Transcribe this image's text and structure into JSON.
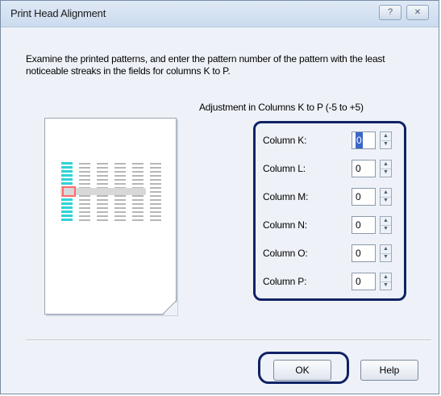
{
  "window": {
    "title": "Print Head Alignment",
    "help_glyph": "?",
    "close_glyph": "✕"
  },
  "instructions": "Examine the printed patterns, and enter the pattern number of the pattern with the least noticeable streaks in the fields for columns K to P.",
  "adjustment_label": "Adjustment in Columns K to P (-5 to +5)",
  "columns": [
    {
      "label": "Column K:",
      "value": "0"
    },
    {
      "label": "Column L:",
      "value": "0"
    },
    {
      "label": "Column M:",
      "value": "0"
    },
    {
      "label": "Column N:",
      "value": "0"
    },
    {
      "label": "Column O:",
      "value": "0"
    },
    {
      "label": "Column P:",
      "value": "0"
    }
  ],
  "buttons": {
    "ok": "OK",
    "help": "Help"
  },
  "colors": {
    "cyan_pattern": "#30d2d8",
    "grey_pattern": "#b7b7b7",
    "highlight_ring": "#102266",
    "selection_marker": "#ff6a6a"
  }
}
